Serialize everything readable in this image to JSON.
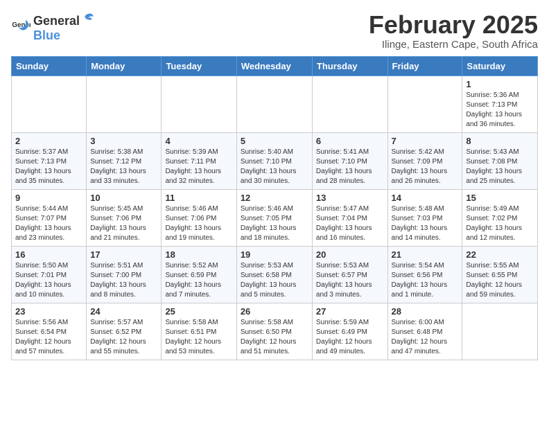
{
  "header": {
    "logo_general": "General",
    "logo_blue": "Blue",
    "title": "February 2025",
    "subtitle": "Ilinge, Eastern Cape, South Africa"
  },
  "weekdays": [
    "Sunday",
    "Monday",
    "Tuesday",
    "Wednesday",
    "Thursday",
    "Friday",
    "Saturday"
  ],
  "weeks": [
    [
      {
        "day": "",
        "info": ""
      },
      {
        "day": "",
        "info": ""
      },
      {
        "day": "",
        "info": ""
      },
      {
        "day": "",
        "info": ""
      },
      {
        "day": "",
        "info": ""
      },
      {
        "day": "",
        "info": ""
      },
      {
        "day": "1",
        "info": "Sunrise: 5:36 AM\nSunset: 7:13 PM\nDaylight: 13 hours\nand 36 minutes."
      }
    ],
    [
      {
        "day": "2",
        "info": "Sunrise: 5:37 AM\nSunset: 7:13 PM\nDaylight: 13 hours\nand 35 minutes."
      },
      {
        "day": "3",
        "info": "Sunrise: 5:38 AM\nSunset: 7:12 PM\nDaylight: 13 hours\nand 33 minutes."
      },
      {
        "day": "4",
        "info": "Sunrise: 5:39 AM\nSunset: 7:11 PM\nDaylight: 13 hours\nand 32 minutes."
      },
      {
        "day": "5",
        "info": "Sunrise: 5:40 AM\nSunset: 7:10 PM\nDaylight: 13 hours\nand 30 minutes."
      },
      {
        "day": "6",
        "info": "Sunrise: 5:41 AM\nSunset: 7:10 PM\nDaylight: 13 hours\nand 28 minutes."
      },
      {
        "day": "7",
        "info": "Sunrise: 5:42 AM\nSunset: 7:09 PM\nDaylight: 13 hours\nand 26 minutes."
      },
      {
        "day": "8",
        "info": "Sunrise: 5:43 AM\nSunset: 7:08 PM\nDaylight: 13 hours\nand 25 minutes."
      }
    ],
    [
      {
        "day": "9",
        "info": "Sunrise: 5:44 AM\nSunset: 7:07 PM\nDaylight: 13 hours\nand 23 minutes."
      },
      {
        "day": "10",
        "info": "Sunrise: 5:45 AM\nSunset: 7:06 PM\nDaylight: 13 hours\nand 21 minutes."
      },
      {
        "day": "11",
        "info": "Sunrise: 5:46 AM\nSunset: 7:06 PM\nDaylight: 13 hours\nand 19 minutes."
      },
      {
        "day": "12",
        "info": "Sunrise: 5:46 AM\nSunset: 7:05 PM\nDaylight: 13 hours\nand 18 minutes."
      },
      {
        "day": "13",
        "info": "Sunrise: 5:47 AM\nSunset: 7:04 PM\nDaylight: 13 hours\nand 16 minutes."
      },
      {
        "day": "14",
        "info": "Sunrise: 5:48 AM\nSunset: 7:03 PM\nDaylight: 13 hours\nand 14 minutes."
      },
      {
        "day": "15",
        "info": "Sunrise: 5:49 AM\nSunset: 7:02 PM\nDaylight: 13 hours\nand 12 minutes."
      }
    ],
    [
      {
        "day": "16",
        "info": "Sunrise: 5:50 AM\nSunset: 7:01 PM\nDaylight: 13 hours\nand 10 minutes."
      },
      {
        "day": "17",
        "info": "Sunrise: 5:51 AM\nSunset: 7:00 PM\nDaylight: 13 hours\nand 8 minutes."
      },
      {
        "day": "18",
        "info": "Sunrise: 5:52 AM\nSunset: 6:59 PM\nDaylight: 13 hours\nand 7 minutes."
      },
      {
        "day": "19",
        "info": "Sunrise: 5:53 AM\nSunset: 6:58 PM\nDaylight: 13 hours\nand 5 minutes."
      },
      {
        "day": "20",
        "info": "Sunrise: 5:53 AM\nSunset: 6:57 PM\nDaylight: 13 hours\nand 3 minutes."
      },
      {
        "day": "21",
        "info": "Sunrise: 5:54 AM\nSunset: 6:56 PM\nDaylight: 13 hours\nand 1 minute."
      },
      {
        "day": "22",
        "info": "Sunrise: 5:55 AM\nSunset: 6:55 PM\nDaylight: 12 hours\nand 59 minutes."
      }
    ],
    [
      {
        "day": "23",
        "info": "Sunrise: 5:56 AM\nSunset: 6:54 PM\nDaylight: 12 hours\nand 57 minutes."
      },
      {
        "day": "24",
        "info": "Sunrise: 5:57 AM\nSunset: 6:52 PM\nDaylight: 12 hours\nand 55 minutes."
      },
      {
        "day": "25",
        "info": "Sunrise: 5:58 AM\nSunset: 6:51 PM\nDaylight: 12 hours\nand 53 minutes."
      },
      {
        "day": "26",
        "info": "Sunrise: 5:58 AM\nSunset: 6:50 PM\nDaylight: 12 hours\nand 51 minutes."
      },
      {
        "day": "27",
        "info": "Sunrise: 5:59 AM\nSunset: 6:49 PM\nDaylight: 12 hours\nand 49 minutes."
      },
      {
        "day": "28",
        "info": "Sunrise: 6:00 AM\nSunset: 6:48 PM\nDaylight: 12 hours\nand 47 minutes."
      },
      {
        "day": "",
        "info": ""
      }
    ]
  ]
}
